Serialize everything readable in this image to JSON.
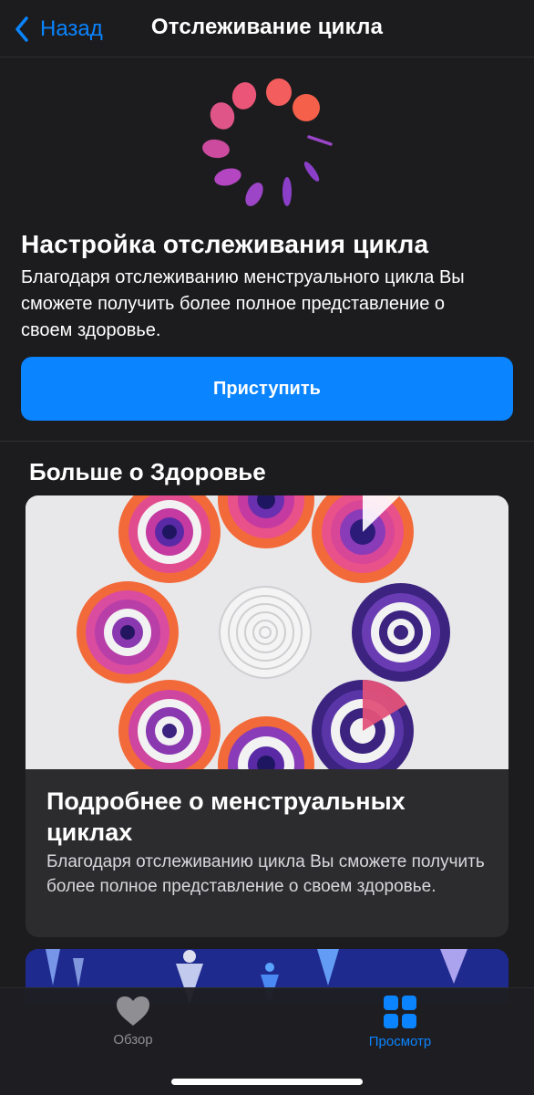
{
  "navbar": {
    "back_label": "Назад",
    "title": "Отслеживание цикла"
  },
  "setup": {
    "icon": "cycle-tracking-icon",
    "title": "Настройка отслеживания цикла",
    "description": "Благодаря отслеживанию менструального цикла Вы сможете получить более полное представление о своем здоровье.",
    "button_label": "Приступить"
  },
  "more_section": {
    "title": "Больше о Здоровье",
    "article": {
      "image": "paper-cut-cycle-rings-illustration",
      "title": "Подробнее о менструальных циклах",
      "description": "Благодаря отслеживанию цикла Вы сможете получить более полное представление о своем здоровье."
    },
    "next_card_image": "figures-illustration"
  },
  "tabbar": {
    "items": [
      {
        "label": "Обзор",
        "icon": "heart-icon",
        "active": false
      },
      {
        "label": "Просмотр",
        "icon": "grid-icon",
        "active": true
      }
    ]
  },
  "colors": {
    "accent": "#0a84ff",
    "background": "#1c1c1e",
    "card": "#2c2c2e"
  }
}
